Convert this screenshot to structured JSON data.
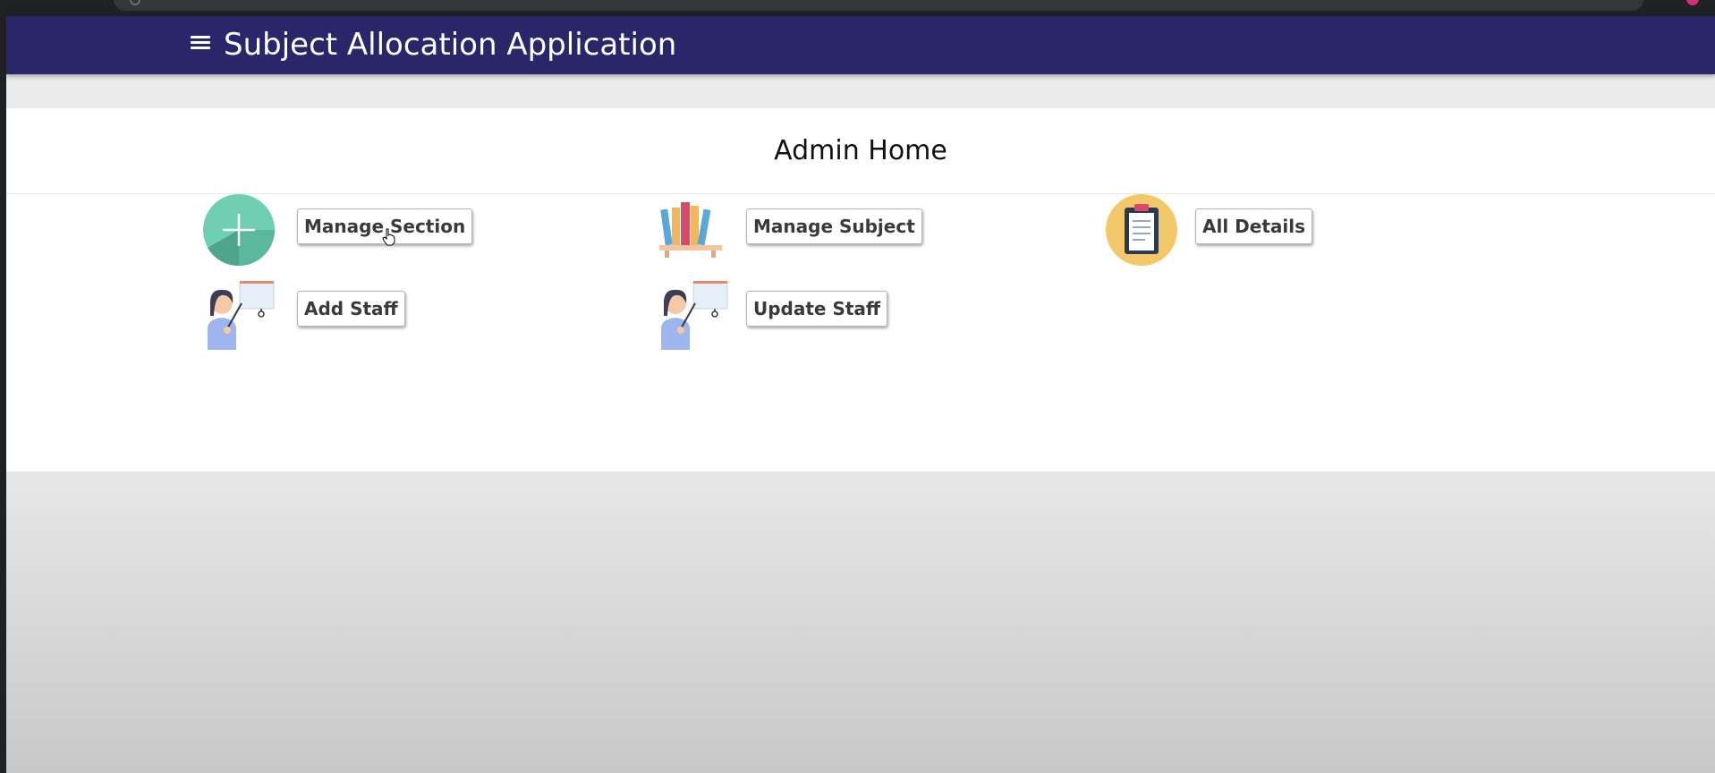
{
  "app": {
    "title": "Subject Allocation Application"
  },
  "page": {
    "title": "Admin Home"
  },
  "tiles": [
    {
      "label": "Manage Section",
      "icon": "add-circle-icon"
    },
    {
      "label": "Manage Subject",
      "icon": "bookshelf-icon"
    },
    {
      "label": "All Details",
      "icon": "clipboard-icon"
    },
    {
      "label": "Add Staff",
      "icon": "teacher-icon"
    },
    {
      "label": "Update Staff",
      "icon": "teacher-icon"
    }
  ],
  "colors": {
    "navbar": "#29266a",
    "accent_green": "#6fcfb0",
    "accent_yellow": "#f2c86a"
  }
}
